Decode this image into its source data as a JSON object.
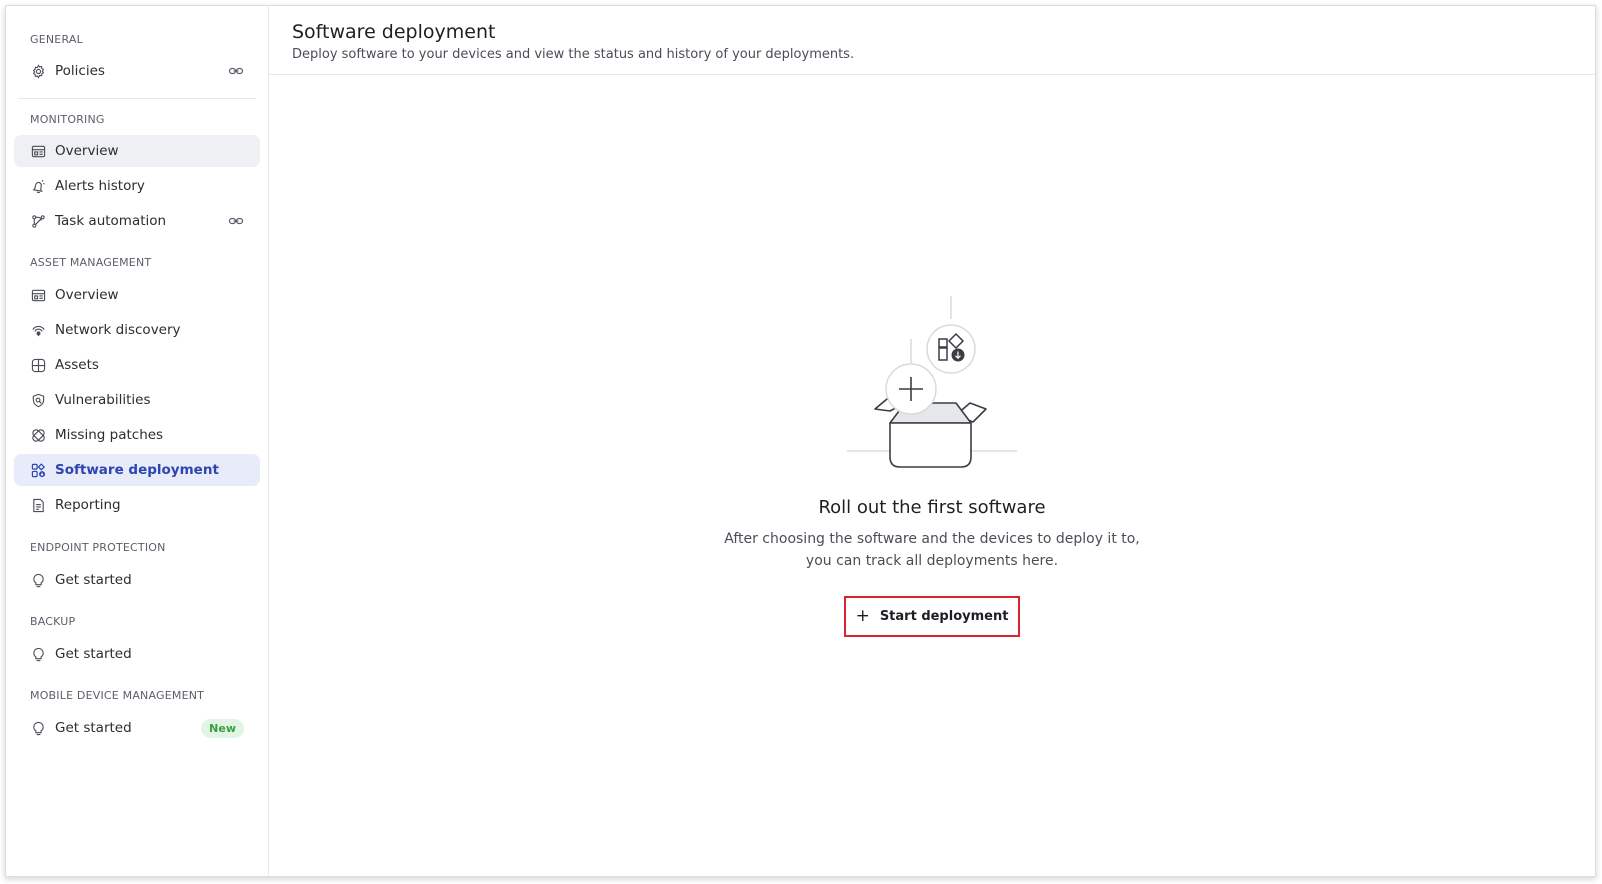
{
  "sidebar": {
    "sections": {
      "general": "GENERAL",
      "monitoring": "MONITORING",
      "asset_management": "ASSET MANAGEMENT",
      "endpoint_protection": "ENDPOINT PROTECTION",
      "backup": "BACKUP",
      "mdm": "MOBILE DEVICE MANAGEMENT"
    },
    "items": {
      "policies": "Policies",
      "monitoring_overview": "Overview",
      "alerts_history": "Alerts history",
      "task_automation": "Task automation",
      "asset_overview": "Overview",
      "network_discovery": "Network discovery",
      "assets": "Assets",
      "vulnerabilities": "Vulnerabilities",
      "missing_patches": "Missing patches",
      "software_deployment": "Software deployment",
      "reporting": "Reporting",
      "ep_get_started": "Get started",
      "backup_get_started": "Get started",
      "mdm_get_started": "Get started"
    },
    "badge_new": "New"
  },
  "header": {
    "title": "Software deployment",
    "subtitle": "Deploy software to your devices and view the status and history of your deployments."
  },
  "empty_state": {
    "title": "Roll out the first software",
    "text_line1": "After choosing the software and the devices to deploy it to,",
    "text_line2": "you can track all deployments here.",
    "button_label": "Start deployment"
  },
  "colors": {
    "active_text": "#2d45b0",
    "active_bg": "#e8ecfa",
    "highlight_border": "#d9252e",
    "new_badge": "#3a9d46"
  }
}
